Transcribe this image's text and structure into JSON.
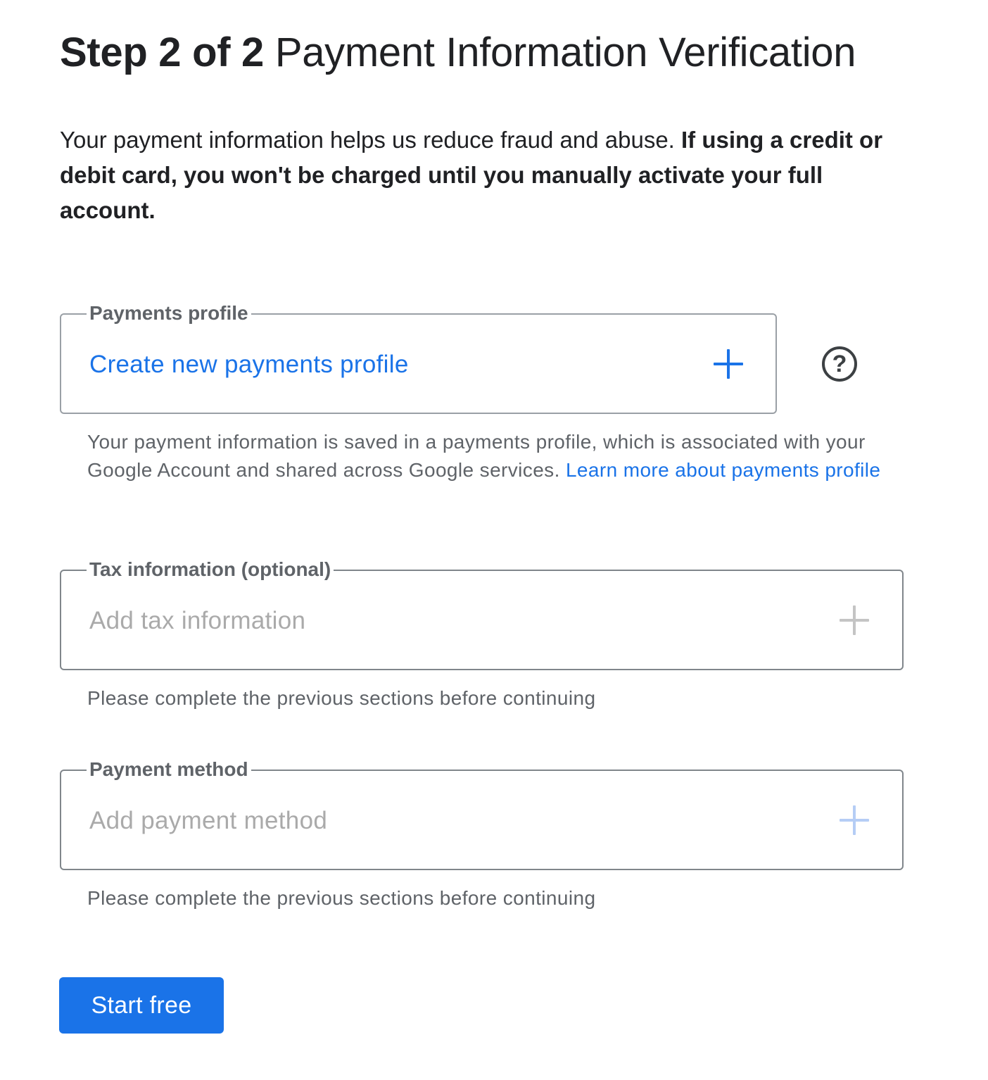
{
  "header": {
    "step_label": "Step 2 of 2",
    "title": "Payment Information Verification"
  },
  "intro": {
    "text": "Your payment information helps us reduce fraud and abuse.",
    "bold_text": "If using a credit or debit card, you won't be charged until you manually activate your full account."
  },
  "payments_profile": {
    "legend": "Payments profile",
    "value": "Create new payments profile",
    "add_icon": "plus-icon",
    "help_icon": "question-circle-icon",
    "help_symbol": "?",
    "helper_text": "Your payment information is saved in a payments profile, which is associated with your Google Account and shared across Google services.",
    "learn_more_link": "Learn more about payments profile"
  },
  "tax_information": {
    "legend": "Tax information (optional)",
    "value": "Add tax information",
    "add_icon": "plus-icon",
    "helper_text": "Please complete the previous sections before continuing"
  },
  "payment_method": {
    "legend": "Payment method",
    "value": "Add payment method",
    "add_icon": "plus-icon",
    "helper_text": "Please complete the previous sections before continuing"
  },
  "actions": {
    "start_label": "Start free"
  },
  "colors": {
    "accent": "#1a73e8",
    "text": "#202124",
    "muted": "#5f6368",
    "disabled": "#aaaaaa"
  }
}
